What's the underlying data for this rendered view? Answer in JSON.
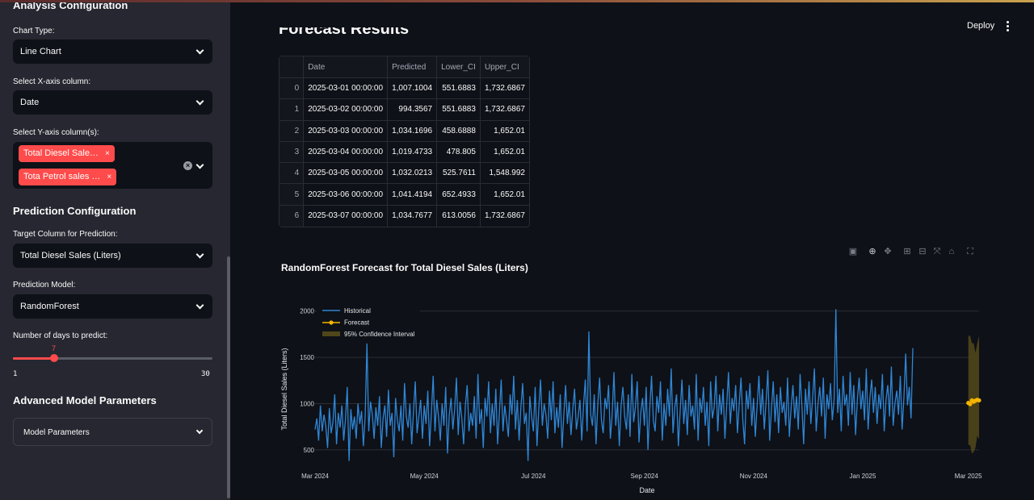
{
  "sidebar": {
    "section_analysis": "Analysis Configuration",
    "chart_type_label": "Chart Type:",
    "chart_type_value": "Line Chart",
    "x_axis_label": "Select X-axis column:",
    "x_axis_value": "Date",
    "y_axis_label": "Select Y-axis column(s):",
    "y_axis_tags": [
      "Total Diesel Sale…",
      "Tota Petrol sales …"
    ],
    "section_prediction": "Prediction Configuration",
    "target_label": "Target Column for Prediction:",
    "target_value": "Total Diesel Sales (Liters)",
    "model_label": "Prediction Model:",
    "model_value": "RandomForest",
    "days_label": "Number of days to predict:",
    "days_value": "7",
    "days_min": "1",
    "days_max": "30",
    "days_fraction": 0.2069,
    "section_advanced": "Advanced Model Parameters",
    "model_params_label": "Model Parameters"
  },
  "header": {
    "deploy_label": "Deploy"
  },
  "main": {
    "heading": "Forecast Results",
    "table": {
      "columns": [
        "",
        "Date",
        "Predicted",
        "Lower_CI",
        "Upper_CI"
      ],
      "rows": [
        [
          "0",
          "2025-03-01 00:00:00",
          "1,007.1004",
          "551.6883",
          "1,732.6867"
        ],
        [
          "1",
          "2025-03-02 00:00:00",
          "994.3567",
          "551.6883",
          "1,732.6867"
        ],
        [
          "2",
          "2025-03-03 00:00:00",
          "1,034.1696",
          "458.6888",
          "1,652.01"
        ],
        [
          "3",
          "2025-03-04 00:00:00",
          "1,019.4733",
          "478.805",
          "1,652.01"
        ],
        [
          "4",
          "2025-03-05 00:00:00",
          "1,032.0213",
          "525.7611",
          "1,548.992"
        ],
        [
          "5",
          "2025-03-06 00:00:00",
          "1,041.4194",
          "652.4933",
          "1,652.01"
        ],
        [
          "6",
          "2025-03-07 00:00:00",
          "1,034.7677",
          "613.0056",
          "1,732.6867"
        ]
      ]
    },
    "chart_title": "RandomForest Forecast for Total Diesel Sales (Liters)"
  },
  "colors": {
    "accent": "#ff4b4b",
    "historical": "#2f86d6",
    "forecast": "#f5b400",
    "ci": "#4f4619"
  },
  "chart_data": {
    "type": "line",
    "title": "RandomForest Forecast for Total Diesel Sales (Liters)",
    "xlabel": "Date",
    "ylabel": "Total Diesel Sales (Liters)",
    "x_ticks": [
      "Mar 2024",
      "May 2024",
      "Jul 2024",
      "Sep 2024",
      "Nov 2024",
      "Jan 2025",
      "Mar 2025"
    ],
    "y_ticks": [
      500,
      1000,
      1500,
      2000
    ],
    "xlim": [
      "2024-03-01",
      "2025-03-07"
    ],
    "ylim": [
      350,
      2050
    ],
    "legend": [
      "Historical",
      "Forecast",
      "95% Confidence Interval"
    ],
    "legend_position": "top-left",
    "grid": true,
    "series": [
      {
        "name": "Historical",
        "start_date": "2024-03-01",
        "values": [
          720,
          840,
          600,
          980,
          700,
          880,
          760,
          520,
          950,
          680,
          800,
          1100,
          560,
          900,
          740,
          980,
          600,
          830,
          1180,
          380,
          940,
          720,
          860,
          620,
          1000,
          780,
          920,
          540,
          860,
          1650,
          700,
          1020,
          880,
          620,
          960,
          760,
          1080,
          520,
          840,
          980,
          640,
          1150,
          760,
          900,
          420,
          1060,
          820,
          700,
          980,
          600,
          1220,
          860,
          740,
          1000,
          560,
          920,
          1240,
          680,
          860,
          1040,
          620,
          980,
          780,
          1140,
          540,
          900,
          1300,
          700,
          1040,
          860,
          600,
          1000,
          760,
          1180,
          460,
          880,
          1060,
          720,
          940,
          1280,
          660,
          1020,
          840,
          560,
          980,
          1200,
          700,
          900,
          760,
          1080,
          620,
          1320,
          780,
          940,
          520,
          1060,
          860,
          1240,
          680,
          1000,
          760,
          1160,
          560,
          900,
          1260,
          700,
          980,
          820,
          640,
          1100,
          880,
          1300,
          720,
          1040,
          600,
          960,
          1220,
          780,
          900,
          380,
          1080,
          860,
          700,
          1180,
          540,
          940,
          1260,
          760,
          1000,
          880,
          620,
          1140,
          820,
          1240,
          680,
          960,
          740,
          1100,
          520,
          880,
          1200,
          780,
          1020,
          660,
          940,
          1160,
          720,
          860,
          1040,
          600,
          980,
          1260,
          700,
          1780,
          880,
          760,
          1100,
          560,
          1000,
          1280,
          820,
          680,
          1060,
          940,
          1200,
          620,
          880,
          1340,
          760,
          1020,
          540,
          980,
          1180,
          860,
          720,
          1100,
          640,
          1320,
          800,
          960,
          1240,
          580,
          900,
          1060,
          760,
          1180,
          500,
          940,
          1300,
          820,
          700,
          1080,
          900,
          1240,
          600,
          1000,
          760,
          1160,
          860,
          1380,
          680,
          960,
          1100,
          540,
          920,
          1260,
          780,
          1040,
          660,
          1200,
          860,
          980,
          720,
          1320,
          600,
          1060,
          900,
          1180,
          760,
          1020,
          540,
          1240,
          840,
          960,
          1300,
          700,
          1100,
          880,
          1160,
          620,
          980,
          1340,
          780,
          1060,
          920,
          1200,
          680,
          1000,
          1280,
          820,
          560,
          1140,
          940,
          1220,
          760,
          1060,
          640,
          980,
          1300,
          880,
          1160,
          720,
          1020,
          1360,
          600,
          940,
          1240,
          800,
          1100,
          680,
          1180,
          900,
          1020,
          760,
          1280,
          640,
          960,
          1200,
          840,
          1080,
          720,
          1320,
          980,
          560,
          1160,
          880,
          1240,
          780,
          1060,
          1380,
          700,
          1000,
          1180,
          860,
          1280,
          620,
          1100,
          940,
          1220,
          820,
          1040,
          2020,
          900,
          1160,
          700,
          1300,
          980,
          1100,
          760,
          1340,
          880,
          1200,
          660,
          1040,
          1280,
          940,
          1140,
          820,
          1380,
          720,
          1060,
          1260,
          900,
          1180,
          780,
          1100,
          940,
          1320,
          700,
          1040,
          1200,
          860,
          1400,
          760,
          1000,
          1140,
          880,
          1300,
          720,
          1060,
          1540,
          980,
          1180,
          840,
          1600
        ]
      },
      {
        "name": "Forecast",
        "x": [
          "2025-03-01",
          "2025-03-02",
          "2025-03-03",
          "2025-03-04",
          "2025-03-05",
          "2025-03-06",
          "2025-03-07"
        ],
        "values": [
          1007.1004,
          994.3567,
          1034.1696,
          1019.4733,
          1032.0213,
          1041.4194,
          1034.7677
        ]
      },
      {
        "name": "95% Confidence Interval",
        "x": [
          "2025-03-01",
          "2025-03-02",
          "2025-03-03",
          "2025-03-04",
          "2025-03-05",
          "2025-03-06",
          "2025-03-07"
        ],
        "lower": [
          551.6883,
          551.6883,
          458.6888,
          478.805,
          525.7611,
          652.4933,
          613.0056
        ],
        "upper": [
          1732.6867,
          1732.6867,
          1652.01,
          1652.01,
          1548.992,
          1652.01,
          1732.6867
        ]
      }
    ]
  }
}
